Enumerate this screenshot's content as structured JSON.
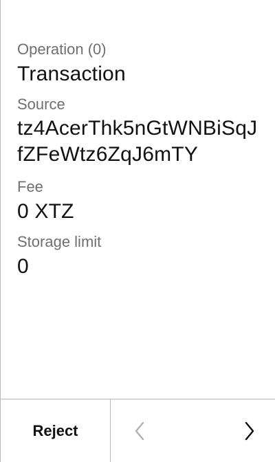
{
  "operation": {
    "header_label": "Operation (0)",
    "type_value": "Transaction"
  },
  "source": {
    "label": "Source",
    "value": "tz4AcerThk5nGtWNBiSqJfZFeWtz6ZqJ6mTY"
  },
  "fee": {
    "label": "Fee",
    "value": "0 XTZ"
  },
  "storage_limit": {
    "label": "Storage limit",
    "value": "0"
  },
  "footer": {
    "reject_label": "Reject",
    "prev_icon": "chevron-left-icon",
    "next_icon": "chevron-right-icon",
    "prev_disabled": true
  },
  "colors": {
    "label_text": "#6f6f6f",
    "value_text": "#111111",
    "divider": "#b8b8b8",
    "disabled_icon": "#b0b0b0"
  }
}
